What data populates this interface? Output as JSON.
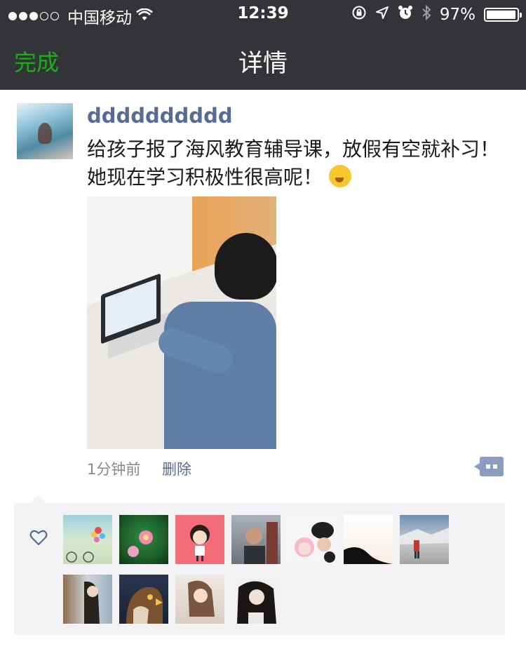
{
  "status_bar": {
    "carrier": "中国移动",
    "time": "12:39",
    "battery_percent": "97%",
    "battery_level": 0.97,
    "signal_bars_filled": 3,
    "signal_bars_total": 5,
    "icons": [
      "wifi-icon",
      "rotation-lock-icon",
      "location-icon",
      "alarm-icon",
      "bluetooth-icon",
      "battery-icon"
    ]
  },
  "nav": {
    "done_label": "完成",
    "title": "详情"
  },
  "post": {
    "username": "dddddddddd",
    "text": "给孩子报了海风教育辅导课，放假有空就补习！她现在学习积极性很高呢！",
    "emoji": "thinking-face-emoji",
    "time_label": "1分钟前",
    "delete_label": "删除"
  },
  "likes": {
    "icon": "heart-outline-icon",
    "avatar_count": 11
  },
  "colors": {
    "nav_bg": "#333438",
    "done_green": "#1aad19",
    "link_blue": "#576b95",
    "likes_bg": "#f3f3f5"
  }
}
